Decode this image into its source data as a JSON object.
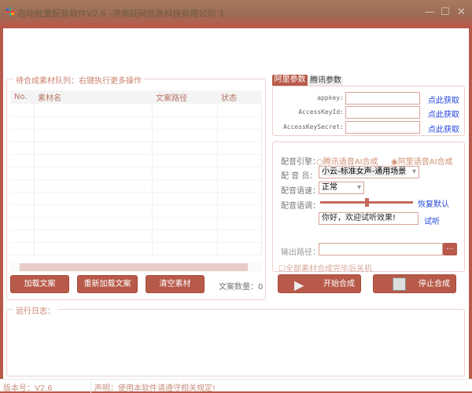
{
  "window": {
    "title": "自动批量配音软件V2.6 -济南跃网信息科技有限公司 1",
    "minimize": "—",
    "maximize": "☐",
    "close": "✕"
  },
  "queue": {
    "title": "待合成素材队列：右键执行更多操作",
    "columns": [
      "No.",
      "素材名",
      "文案路径",
      "状态"
    ],
    "rows": []
  },
  "left_buttons": {
    "load": "加载文案",
    "reload": "重新加载文案",
    "clear": "清空素材"
  },
  "count": {
    "label": "文案数量：",
    "value": "0"
  },
  "tabs": [
    {
      "label": "阿里参数",
      "active": true
    },
    {
      "label": "腾讯参数",
      "active": false
    }
  ],
  "ali": {
    "fields": [
      {
        "label": "appkey:",
        "value": ""
      },
      {
        "label": "AccessKeyId:",
        "value": ""
      },
      {
        "label": "AccessKeySecret:",
        "value": ""
      }
    ],
    "link": "点此获取"
  },
  "voice": {
    "engine_label": "配音引擎：",
    "engines": [
      {
        "label": "腾讯语音AI合成",
        "selected": false
      },
      {
        "label": "阿里语音AI合成",
        "selected": true
      }
    ],
    "speaker_label": "配 音 员：",
    "speaker": "小云-标准女声-通用场景",
    "speed_label": "配音语速：",
    "speed": "正常",
    "pitch_label": "配音语调：",
    "pitch_level": 0.5,
    "reset": "恢复默认",
    "preview_text": "你好，欢迎试听效果!",
    "preview": "试听",
    "output_label": "输出路径：",
    "output": "",
    "browse": "...",
    "shutdown": "全部素材合成完毕后关机",
    "shutdown_checked": false
  },
  "actions": {
    "start": "开始合成",
    "stop": "停止合成"
  },
  "log": {
    "title": "运行日志：",
    "content": ""
  },
  "status": {
    "version": "版本号：V2.6",
    "notice": "声明：使用本软件请遵守相关规定!"
  }
}
